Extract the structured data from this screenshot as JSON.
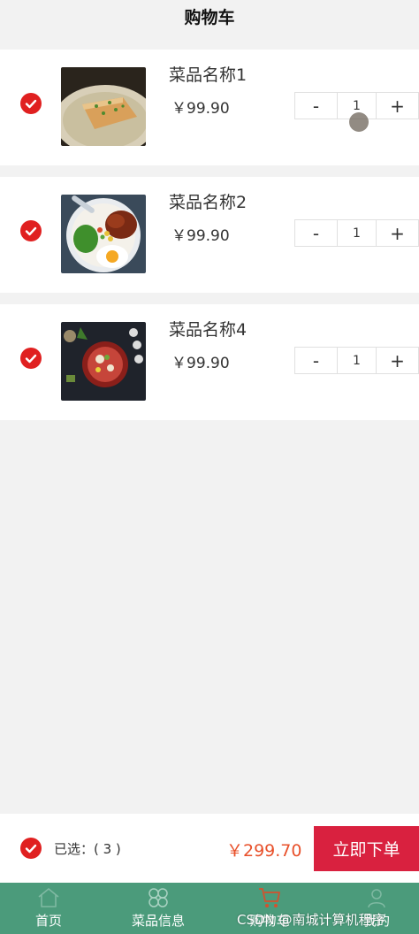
{
  "header": {
    "title": "购物车"
  },
  "cart": {
    "items": [
      {
        "name": "菜品名称1",
        "price": "￥99.90",
        "qty": "1",
        "minus": "-",
        "plus": "+",
        "image_icon": "tofu-dish-photo"
      },
      {
        "name": "菜品名称2",
        "price": "￥99.90",
        "qty": "1",
        "minus": "-",
        "plus": "+",
        "image_icon": "rice-bowl-photo"
      },
      {
        "name": "菜品名称4",
        "price": "￥99.90",
        "qty": "1",
        "minus": "-",
        "plus": "+",
        "image_icon": "soup-pot-photo"
      }
    ]
  },
  "footer": {
    "selected_label": "已选：( 3 )",
    "total": "￥299.70",
    "order_button": "立即下单"
  },
  "tabbar": {
    "tabs": [
      {
        "label": "首页",
        "icon": "home-icon"
      },
      {
        "label": "菜品信息",
        "icon": "grid-icon"
      },
      {
        "label": "购物车",
        "icon": "cart-icon",
        "active": true
      },
      {
        "label": "我的",
        "icon": "user-icon"
      }
    ],
    "watermark": "CSDN @南城计算机程序"
  },
  "colors": {
    "accent_red": "#e02020",
    "order_button": "#d9213f",
    "total_price": "#e8502a",
    "tabbar_bg": "#4b9b7b",
    "page_bg": "#f2f2f2"
  }
}
